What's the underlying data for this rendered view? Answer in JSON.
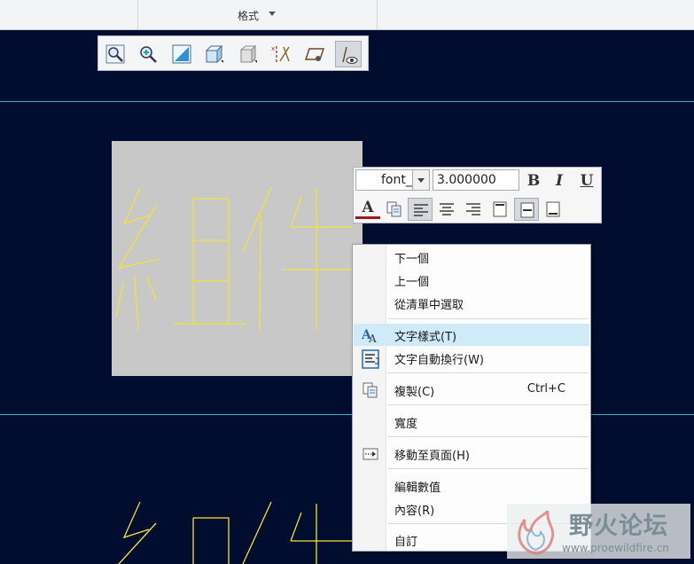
{
  "ribbon": {
    "group_label": "格式"
  },
  "view_toolbar": {
    "buttons": [
      {
        "name": "zoom-fit-icon"
      },
      {
        "name": "zoom-in-icon"
      },
      {
        "name": "refit-icon"
      },
      {
        "name": "display-style-icon"
      },
      {
        "name": "saved-views-icon"
      },
      {
        "name": "datum-display-icon"
      },
      {
        "name": "annotation-display-icon"
      },
      {
        "name": "sketch-view-icon",
        "active": true
      }
    ]
  },
  "text_format_bar": {
    "font_value": "font_",
    "size_value": "3.000000",
    "bold_label": "B",
    "italic_label": "I",
    "underline_label": "U",
    "text_color_label": "A",
    "text_color": "#9b1b1b"
  },
  "canvas": {
    "background": "#000d2e",
    "note_text": "組件",
    "note_color": "#f5e23a",
    "line_color": "#2bb3c8"
  },
  "context_menu": {
    "items": [
      {
        "label": "下一個"
      },
      {
        "label": "上一個"
      },
      {
        "label": "從清單中選取"
      },
      {
        "label": "文字樣式(T)",
        "icon": "text-style-icon",
        "hover": true
      },
      {
        "label": "文字自動換行(W)",
        "icon": "text-wrap-icon"
      },
      {
        "label": "複製(C)",
        "shortcut": "Ctrl+C",
        "icon": "copy-icon"
      },
      {
        "label": "寬度"
      },
      {
        "label": "移動至頁面(H)",
        "icon": "move-to-sheet-icon"
      },
      {
        "label": "編輯數值"
      },
      {
        "label": "內容(R)"
      },
      {
        "label": "自訂"
      }
    ]
  },
  "watermark": {
    "text": "野火论坛",
    "url": "www.proewildfire.cn"
  }
}
